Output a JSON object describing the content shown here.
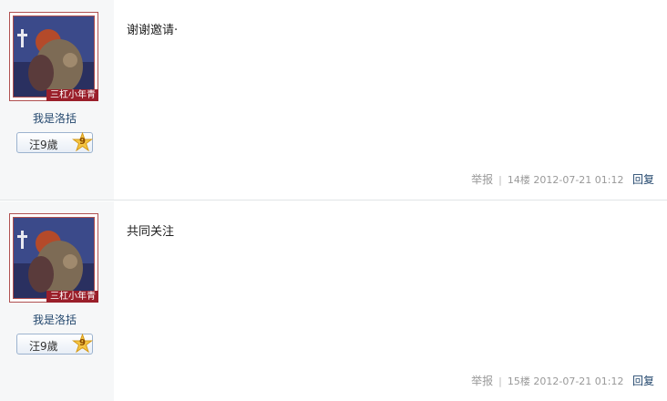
{
  "posts": [
    {
      "avatar_tag": "三杠小年青",
      "username": "我是洛括",
      "badge": {
        "label": "汪9歲",
        "level": "9"
      },
      "content": "谢谢邀请·",
      "report": "举报",
      "floor": "14楼",
      "timestamp": "2012-07-21 01:12",
      "reply": "回复"
    },
    {
      "avatar_tag": "三杠小年青",
      "username": "我是洛括",
      "badge": {
        "label": "汪9歲",
        "level": "9"
      },
      "content": "共同关注",
      "report": "举报",
      "floor": "15楼",
      "timestamp": "2012-07-21 01:12",
      "reply": "回复"
    }
  ],
  "colors": {
    "accent_link": "#24486e",
    "avatar_border": "#b05050",
    "tag_bg": "#9a1f2a",
    "badge_star": "#f5c542"
  }
}
